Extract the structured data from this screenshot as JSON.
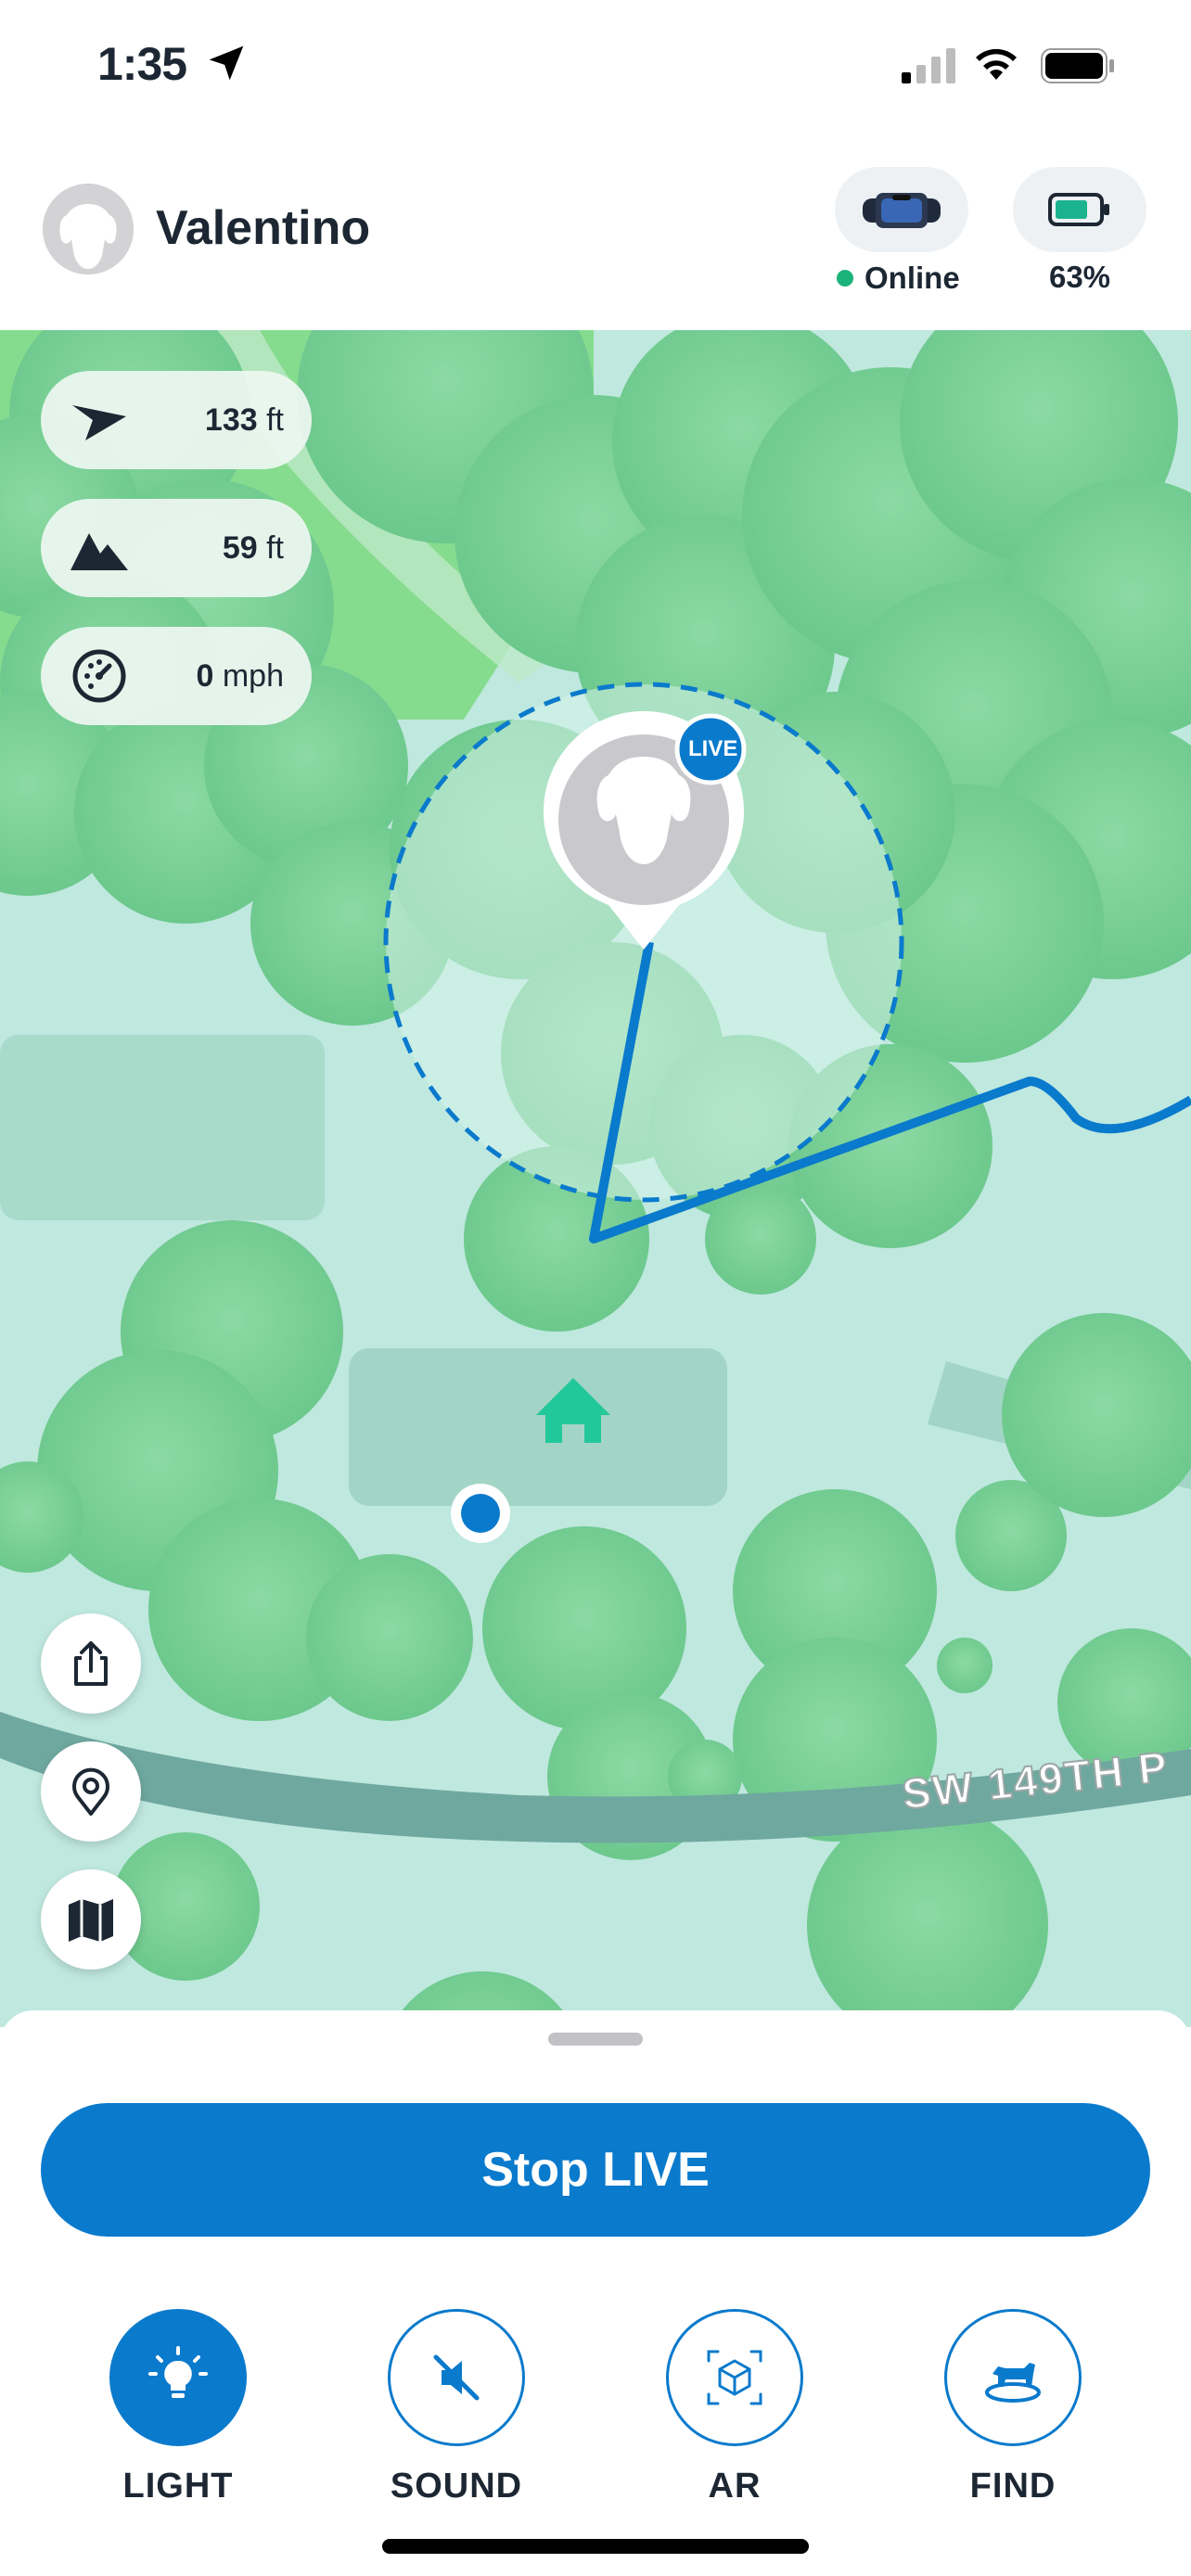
{
  "status_bar": {
    "time": "1:35",
    "icons": [
      "location-arrow-icon",
      "cellular-signal-icon",
      "wifi-icon",
      "battery-icon"
    ]
  },
  "header": {
    "pet_name": "Valentino",
    "device_status": "Online",
    "battery_percent": "63%",
    "icons": [
      "dog-avatar-icon",
      "collar-device-icon",
      "battery-icon"
    ]
  },
  "map": {
    "stats": [
      {
        "icon": "distance-arrow-icon",
        "value": "133",
        "unit": "ft"
      },
      {
        "icon": "altitude-mountain-icon",
        "value": "59",
        "unit": "ft"
      },
      {
        "icon": "speedometer-icon",
        "value": "0",
        "unit": "mph"
      }
    ],
    "live_badge": "LIVE",
    "street_label": "SW 149TH P",
    "controls": [
      "share-icon",
      "location-pin-icon",
      "map-layers-icon"
    ],
    "colors": {
      "track": "#0a7acc",
      "trees": "#7fd49a",
      "ground": "#bfe8df",
      "road": "#6fa89f",
      "home": "#23c89a"
    }
  },
  "sheet": {
    "primary_button": "Stop LIVE",
    "actions": [
      {
        "label": "LIGHT",
        "icon": "lightbulb-icon",
        "active": true
      },
      {
        "label": "SOUND",
        "icon": "sound-muted-icon",
        "active": false
      },
      {
        "label": "AR",
        "icon": "ar-cube-icon",
        "active": false
      },
      {
        "label": "FIND",
        "icon": "find-dog-icon",
        "active": false
      }
    ]
  },
  "accent_color": "#0a7acc"
}
